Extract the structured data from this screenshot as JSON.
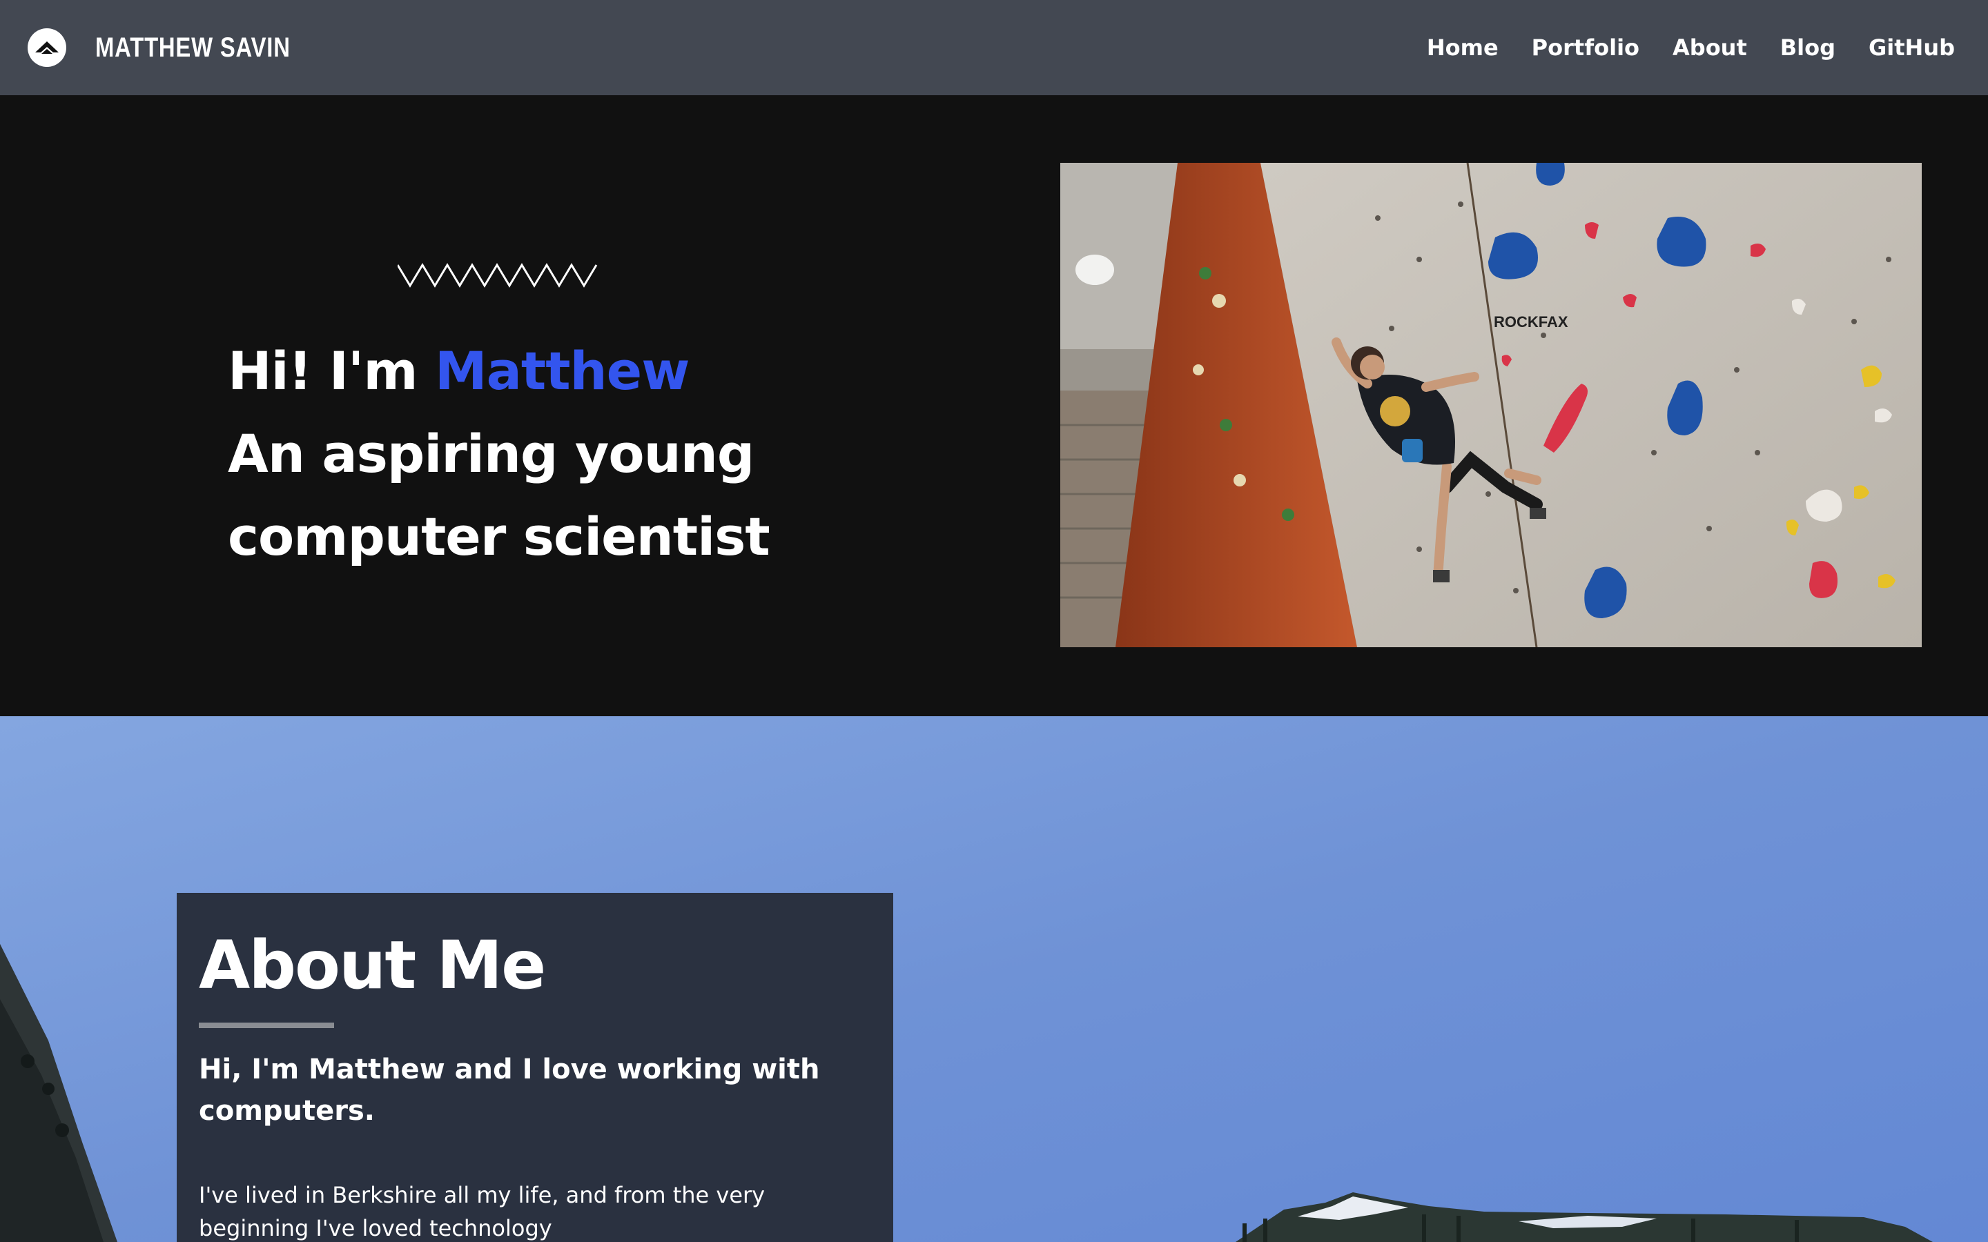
{
  "navbar": {
    "logo_icon": "mountain-logo-icon",
    "brand_name": "MATTHEW SAVIN",
    "links": [
      {
        "label": "Home"
      },
      {
        "label": "Portfolio"
      },
      {
        "label": "About"
      },
      {
        "label": "Blog"
      },
      {
        "label": "GitHub"
      }
    ]
  },
  "hero": {
    "greeting": "Hi! I'm ",
    "name": "Matthew",
    "line2": "An aspiring young",
    "line3": "computer scientist",
    "accent_color": "#3355ee",
    "image_subject": "indoor climbing wall photo",
    "wall_brand_text": "ROCKFAX"
  },
  "about": {
    "title": "About Me",
    "lead": "Hi, I'm Matthew and I love working with computers.",
    "body": "I've lived in Berkshire all my life, and from the very beginning I've loved technology",
    "background_subject": "mountain landscape with blue sky"
  },
  "colors": {
    "navbar_bg": "#434852",
    "hero_bg": "#111111",
    "card_bg": "#2a3140",
    "accent": "#3355ee"
  }
}
